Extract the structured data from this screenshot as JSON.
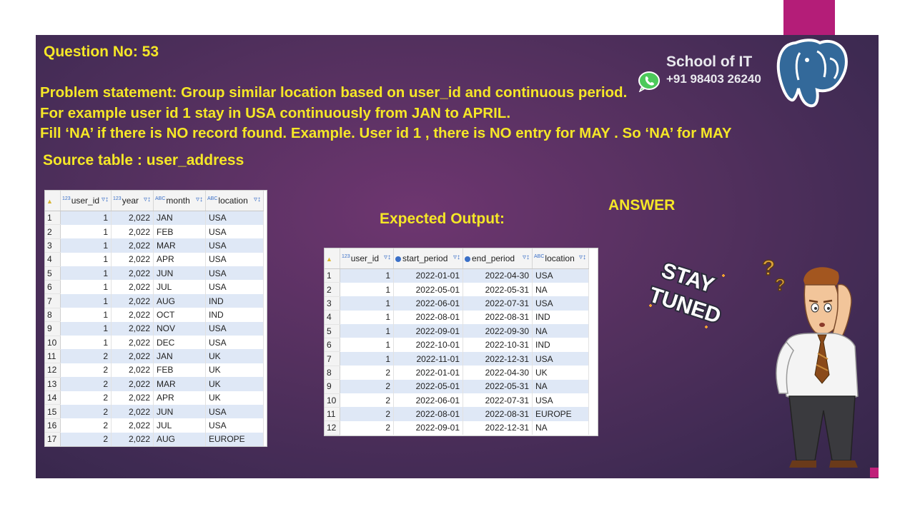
{
  "slide": {
    "question": "Question No: 53",
    "problem_lines": [
      "Problem statement: Group similar location based on user_id and continuous period.",
      "For example user id 1 stay in USA continuously from JAN to APRIL.",
      "Fill ‘NA’ if there is NO record found.  Example. User id 1 , there is NO entry for MAY  . So ‘NA’ for MAY"
    ],
    "source_label": "Source table : user_address",
    "expected_label": "Expected Output:",
    "answer_label": "ANSWER",
    "school": "School of IT",
    "phone": "+91 98403 26240",
    "sticker": [
      "STAY",
      "TUNED"
    ]
  },
  "source_table": {
    "columns": [
      {
        "type": "123",
        "name": "user_id"
      },
      {
        "type": "123",
        "name": "year"
      },
      {
        "type": "ABC",
        "name": "month"
      },
      {
        "type": "ABC",
        "name": "location"
      }
    ],
    "rows": [
      [
        "1",
        "1",
        "2,022",
        "JAN",
        "USA"
      ],
      [
        "2",
        "1",
        "2,022",
        "FEB",
        "USA"
      ],
      [
        "3",
        "1",
        "2,022",
        "MAR",
        "USA"
      ],
      [
        "4",
        "1",
        "2,022",
        "APR",
        "USA"
      ],
      [
        "5",
        "1",
        "2,022",
        "JUN",
        "USA"
      ],
      [
        "6",
        "1",
        "2,022",
        "JUL",
        "USA"
      ],
      [
        "7",
        "1",
        "2,022",
        "AUG",
        "IND"
      ],
      [
        "8",
        "1",
        "2,022",
        "OCT",
        "IND"
      ],
      [
        "9",
        "1",
        "2,022",
        "NOV",
        "USA"
      ],
      [
        "10",
        "1",
        "2,022",
        "DEC",
        "USA"
      ],
      [
        "11",
        "2",
        "2,022",
        "JAN",
        "UK"
      ],
      [
        "12",
        "2",
        "2,022",
        "FEB",
        "UK"
      ],
      [
        "13",
        "2",
        "2,022",
        "MAR",
        "UK"
      ],
      [
        "14",
        "2",
        "2,022",
        "APR",
        "UK"
      ],
      [
        "15",
        "2",
        "2,022",
        "JUN",
        "USA"
      ],
      [
        "16",
        "2",
        "2,022",
        "JUL",
        "USA"
      ],
      [
        "17",
        "2",
        "2,022",
        "AUG",
        "EUROPE"
      ]
    ]
  },
  "output_table": {
    "columns": [
      {
        "type": "123",
        "name": "user_id"
      },
      {
        "type": "clock",
        "name": "start_period"
      },
      {
        "type": "clock",
        "name": "end_period"
      },
      {
        "type": "ABC",
        "name": "location"
      }
    ],
    "rows": [
      [
        "1",
        "1",
        "2022-01-01",
        "2022-04-30",
        "USA"
      ],
      [
        "2",
        "1",
        "2022-05-01",
        "2022-05-31",
        "NA"
      ],
      [
        "3",
        "1",
        "2022-06-01",
        "2022-07-31",
        "USA"
      ],
      [
        "4",
        "1",
        "2022-08-01",
        "2022-08-31",
        "IND"
      ],
      [
        "5",
        "1",
        "2022-09-01",
        "2022-09-30",
        "NA"
      ],
      [
        "6",
        "1",
        "2022-10-01",
        "2022-10-31",
        "IND"
      ],
      [
        "7",
        "1",
        "2022-11-01",
        "2022-12-31",
        "USA"
      ],
      [
        "8",
        "2",
        "2022-01-01",
        "2022-04-30",
        "UK"
      ],
      [
        "9",
        "2",
        "2022-05-01",
        "2022-05-31",
        "NA"
      ],
      [
        "10",
        "2",
        "2022-06-01",
        "2022-07-31",
        "USA"
      ],
      [
        "11",
        "2",
        "2022-08-01",
        "2022-08-31",
        "EUROPE"
      ],
      [
        "12",
        "2",
        "2022-09-01",
        "2022-12-31",
        "NA"
      ]
    ]
  },
  "colors": {
    "headline": "#f5e727",
    "accent": "#b41d78",
    "row_alt": "#dfe8f6"
  }
}
